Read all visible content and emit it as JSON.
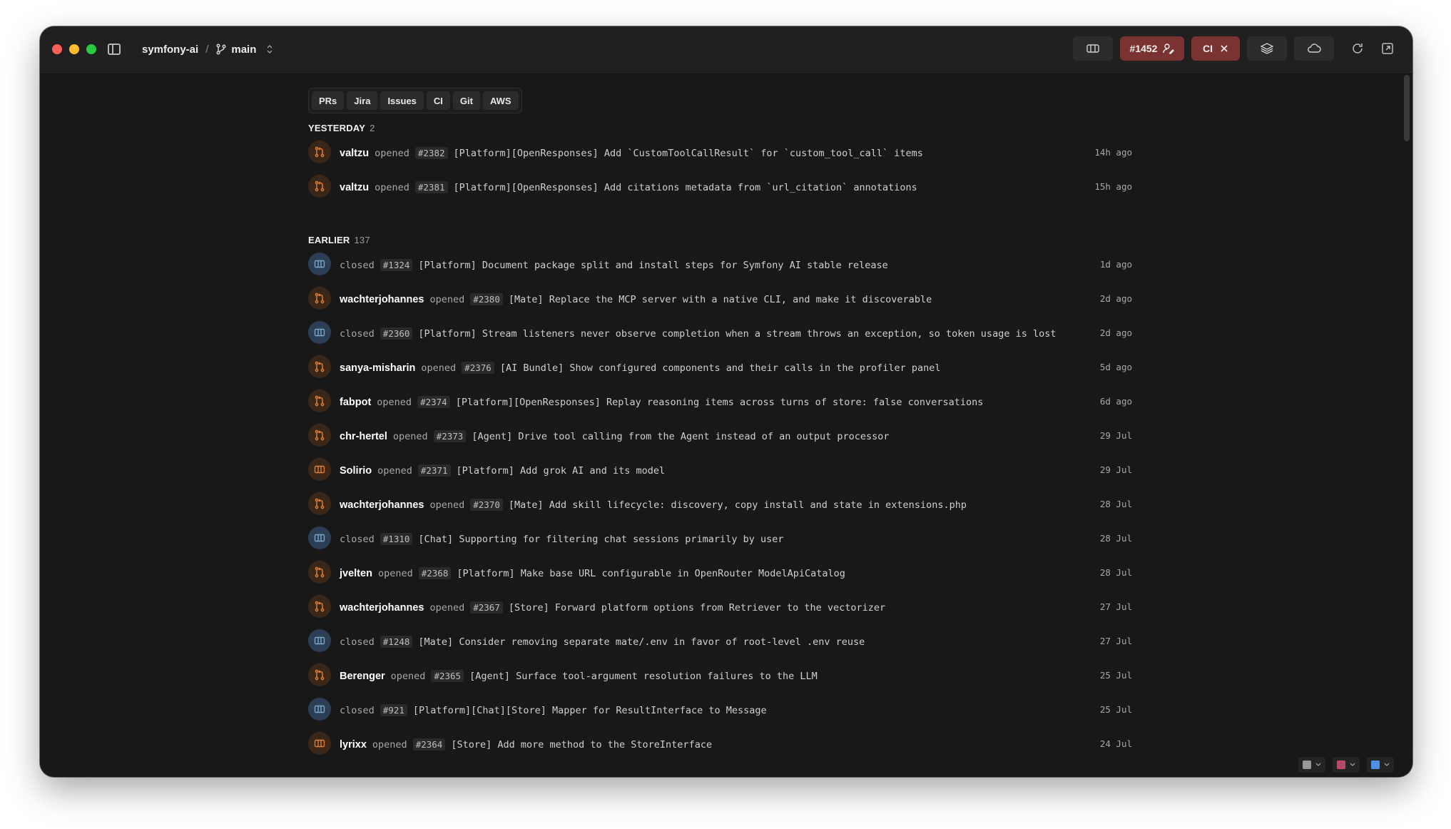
{
  "titlebar": {
    "repo": "symfony-ai",
    "separator": "/",
    "branch": "main",
    "pr_badge": "#1452",
    "ci_badge": "CI"
  },
  "tabs": [
    "PRs",
    "Jira",
    "Issues",
    "CI",
    "Git",
    "AWS"
  ],
  "sections": [
    {
      "label": "YESTERDAY",
      "count": "2",
      "items": [
        {
          "kind": "pr",
          "user": "valtzu",
          "action": "opened",
          "number": "#2382",
          "title": "[Platform][OpenResponses] Add `CustomToolCallResult` for `custom_tool_call` items",
          "time": "14h ago"
        },
        {
          "kind": "pr",
          "user": "valtzu",
          "action": "opened",
          "number": "#2381",
          "title": "[Platform][OpenResponses] Add citations metadata from `url_citation` annotations",
          "time": "15h ago"
        }
      ]
    },
    {
      "label": "EARLIER",
      "count": "137",
      "items": [
        {
          "kind": "issue",
          "user": "",
          "action": "closed",
          "number": "#1324",
          "title": "[Platform] Document package split and install steps for Symfony AI stable release",
          "time": "1d ago"
        },
        {
          "kind": "pr",
          "user": "wachterjohannes",
          "action": "opened",
          "number": "#2380",
          "title": "[Mate] Replace the MCP server with a native CLI, and make it discoverable",
          "time": "2d ago"
        },
        {
          "kind": "issue",
          "user": "",
          "action": "closed",
          "number": "#2360",
          "title": "[Platform] Stream listeners never observe completion when a stream throws an exception, so token usage is lost",
          "time": "2d ago"
        },
        {
          "kind": "pr",
          "user": "sanya-misharin",
          "action": "opened",
          "number": "#2376",
          "title": "[AI Bundle] Show configured components and their calls in the profiler panel",
          "time": "5d ago"
        },
        {
          "kind": "pr",
          "user": "fabpot",
          "action": "opened",
          "number": "#2374",
          "title": "[Platform][OpenResponses] Replay reasoning items across turns of store: false conversations",
          "time": "6d ago"
        },
        {
          "kind": "pr",
          "user": "chr-hertel",
          "action": "opened",
          "number": "#2373",
          "title": "[Agent] Drive tool calling from the Agent instead of an output processor",
          "time": "29 Jul"
        },
        {
          "kind": "issue-orange",
          "user": "Solirio",
          "action": "opened",
          "number": "#2371",
          "title": "[Platform] Add grok AI and its model",
          "time": "29 Jul"
        },
        {
          "kind": "pr",
          "user": "wachterjohannes",
          "action": "opened",
          "number": "#2370",
          "title": "[Mate] Add skill lifecycle: discovery, copy install and state in extensions.php",
          "time": "28 Jul"
        },
        {
          "kind": "issue",
          "user": "",
          "action": "closed",
          "number": "#1310",
          "title": "[Chat] Supporting for filtering chat sessions primarily by user",
          "time": "28 Jul"
        },
        {
          "kind": "pr",
          "user": "jvelten",
          "action": "opened",
          "number": "#2368",
          "title": "[Platform] Make base URL configurable in OpenRouter ModelApiCatalog",
          "time": "28 Jul"
        },
        {
          "kind": "pr",
          "user": "wachterjohannes",
          "action": "opened",
          "number": "#2367",
          "title": "[Store] Forward platform options from Retriever to the vectorizer",
          "time": "27 Jul"
        },
        {
          "kind": "issue",
          "user": "",
          "action": "closed",
          "number": "#1248",
          "title": "[Mate] Consider removing separate mate/.env in favor of root-level .env reuse",
          "time": "27 Jul"
        },
        {
          "kind": "pr",
          "user": "Berenger",
          "action": "opened",
          "number": "#2365",
          "title": "[Agent] Surface tool-argument resolution failures to the LLM",
          "time": "25 Jul"
        },
        {
          "kind": "issue",
          "user": "",
          "action": "closed",
          "number": "#921",
          "title": "[Platform][Chat][Store] Mapper for ResultInterface to Message",
          "time": "25 Jul"
        },
        {
          "kind": "issue-orange",
          "user": "lyrixx",
          "action": "opened",
          "number": "#2364",
          "title": "[Store] Add more method to the StoreInterface",
          "time": "24 Jul"
        }
      ]
    }
  ],
  "colors": {
    "pr_icon": "#e07b32",
    "issue_icon": "#7fa4c4",
    "badge_bg": "#7a3330"
  }
}
